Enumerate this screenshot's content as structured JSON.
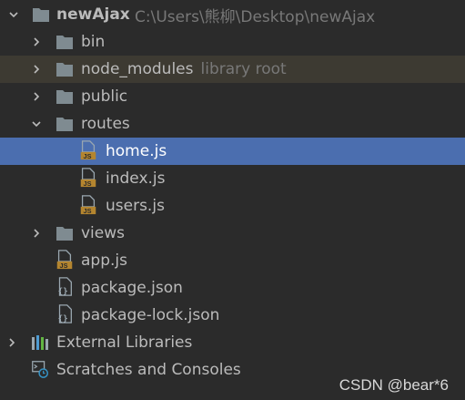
{
  "colors": {
    "background": "#2b2b2b",
    "selection": "#4b6eaf",
    "highlight_row": "#3d3a32",
    "folder": "#7f8b91",
    "js_badge": "#b4852f"
  },
  "project": {
    "name": "newAjax",
    "path": "C:\\Users\\熊柳\\Desktop\\newAjax",
    "icon": "folder-icon"
  },
  "tree": {
    "bin": {
      "label": "bin",
      "icon": "folder-icon"
    },
    "node_modules": {
      "label": "node_modules",
      "hint": "library root",
      "icon": "folder-icon"
    },
    "public": {
      "label": "public",
      "icon": "folder-icon"
    },
    "routes": {
      "label": "routes",
      "icon": "folder-icon",
      "files": [
        {
          "label": "home.js",
          "icon": "js-file-icon",
          "selected": true
        },
        {
          "label": "index.js",
          "icon": "js-file-icon"
        },
        {
          "label": "users.js",
          "icon": "js-file-icon"
        }
      ]
    },
    "views": {
      "label": "views",
      "icon": "folder-icon"
    },
    "app_js": {
      "label": "app.js",
      "icon": "js-file-icon"
    },
    "package_json": {
      "label": "package.json",
      "icon": "json-file-icon"
    },
    "package_lock": {
      "label": "package-lock.json",
      "icon": "json-file-icon"
    }
  },
  "external_libraries": {
    "label": "External Libraries",
    "icon": "library-icon"
  },
  "scratches": {
    "label": "Scratches and Consoles",
    "icon": "scratches-icon"
  },
  "watermark": "CSDN @bear*6"
}
